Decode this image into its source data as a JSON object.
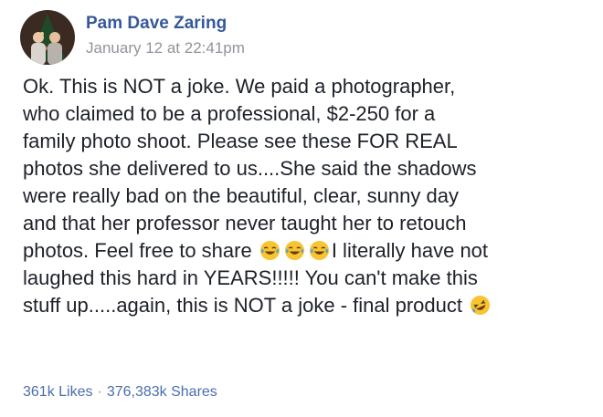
{
  "post": {
    "author": "Pam Dave Zaring",
    "timestamp": "January 12 at 22:41pm",
    "lines": [
      "Ok. This is NOT a joke. We paid a photographer,",
      "who claimed to be a professional, $2-250 for a",
      "family photo shoot. Please see these FOR REAL",
      "photos she delivered to us....She said the shadows",
      "were really bad on the beautiful, clear, sunny day",
      "and that her professor never taught her to retouch"
    ],
    "line7_before": "photos. Feel free to share",
    "line7_after": "I literally have not",
    "line8": "laughed this hard in YEARS!!!!! You can't make this",
    "line9": "stuff up.....again, this is NOT a joke - final product",
    "emojis": {
      "tears_of_joy": "face-with-tears-of-joy-icon",
      "rolling_laughing": "rolling-on-floor-laughing-icon"
    }
  },
  "stats": {
    "likes": "361k Likes",
    "separator": "·",
    "shares": "376,383k Shares"
  },
  "colors": {
    "author": "#365899",
    "timestamp": "#90949c",
    "body_text": "#1d2129",
    "stats": "#4b6eab",
    "emoji_face": "#f7c531",
    "emoji_tear": "#4aa3df"
  }
}
